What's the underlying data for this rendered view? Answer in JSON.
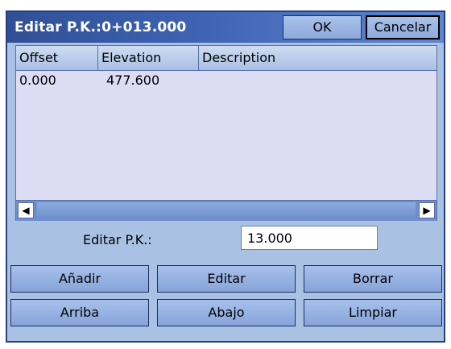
{
  "dialog": {
    "title": "Editar P.K.:0+013.000",
    "ok_label": "OK",
    "cancel_label": "Cancelar"
  },
  "table": {
    "columns": [
      "Offset",
      "Elevation",
      "Description"
    ],
    "rows": [
      {
        "offset": "0.000",
        "elevation": "477.600",
        "description": ""
      }
    ]
  },
  "pk": {
    "label": "Editar P.K.:",
    "value": "13.000"
  },
  "buttons": {
    "add": "Añadir",
    "edit": "Editar",
    "delete": "Borrar",
    "up": "Arriba",
    "down": "Abajo",
    "clear": "Limpiar"
  },
  "icons": {
    "scroll_left": "scroll-left-arrow",
    "scroll_right": "scroll-right-arrow"
  }
}
